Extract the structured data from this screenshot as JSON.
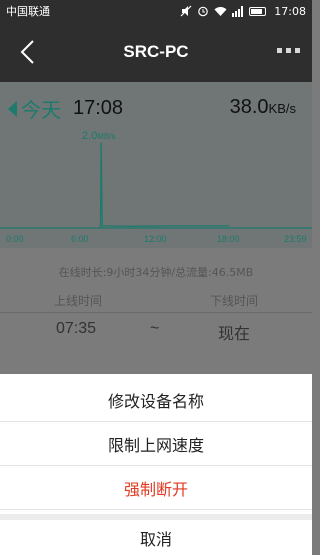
{
  "status": {
    "carrier": "中国联通",
    "time": "17:08"
  },
  "header": {
    "title": "SRC-PC"
  },
  "chart": {
    "today": "今天",
    "clock": "17:08",
    "speed_value": "38.0",
    "speed_unit": "KB/s",
    "peak_value": "2.0",
    "peak_unit": "MB/s",
    "accent": "#1d7a6d"
  },
  "chart_data": {
    "type": "line",
    "x_ticks": [
      "0:00",
      "6:00",
      "12:00",
      "18:00",
      "23:59"
    ],
    "series": [
      {
        "values": [
          [
            7.6,
            0
          ],
          [
            7.65,
            2.0
          ],
          [
            7.75,
            0.05
          ],
          [
            10,
            0.04
          ],
          [
            14,
            0.05
          ],
          [
            18.2,
            0.05
          ]
        ]
      }
    ],
    "ylim": [
      0,
      2.2
    ],
    "xlim": [
      0,
      24
    ]
  },
  "info": {
    "summary": "在线时长:9小时34分钟/总流量:46.5MB",
    "online_label": "上线时间",
    "offline_label": "下线时间",
    "online_value": "07:35",
    "tilde": "~",
    "offline_value": "现在"
  },
  "sheet": {
    "items": [
      {
        "label": "修改设备名称"
      },
      {
        "label": "限制上网速度"
      },
      {
        "label": "强制断开"
      }
    ],
    "cancel": "取消"
  }
}
